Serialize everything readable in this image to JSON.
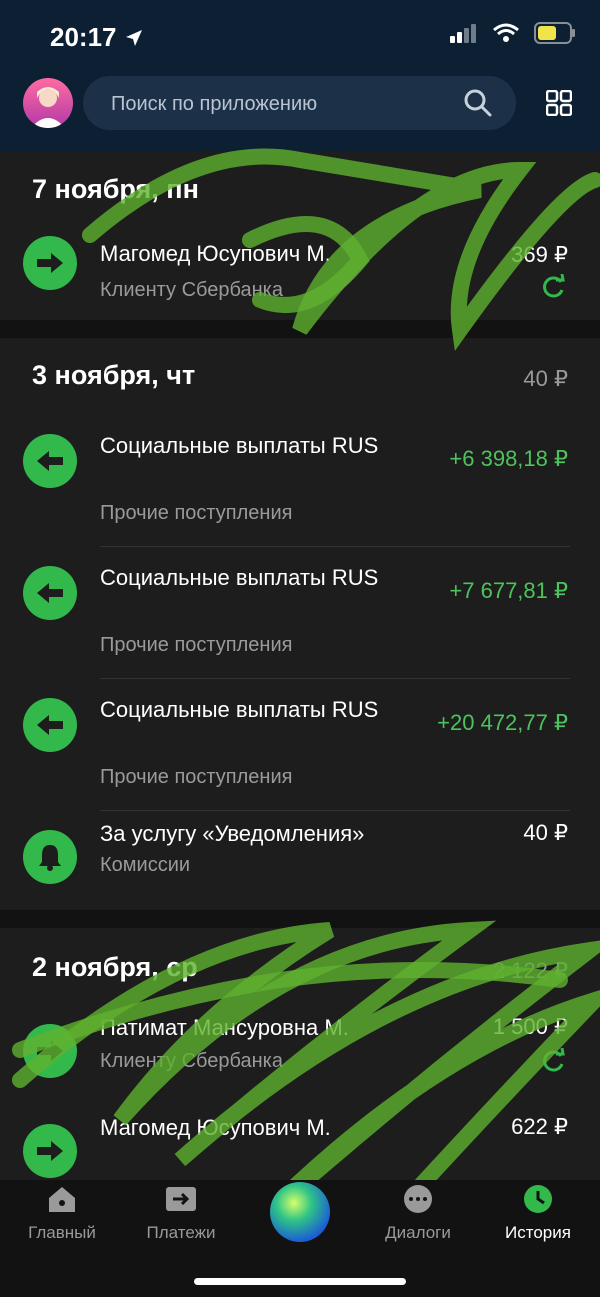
{
  "status": {
    "time": "20:17"
  },
  "search": {
    "placeholder": "Поиск по приложению"
  },
  "sections": [
    {
      "date": "7 ноября, пн",
      "total": "",
      "items": [
        {
          "title": "Магомед Юсупович М.",
          "subtitle": "Клиенту Сбербанка",
          "amount": "369 ₽",
          "icon": "transfer-icon"
        }
      ]
    },
    {
      "date": "3 ноября, чт",
      "total": "40 ₽",
      "items": [
        {
          "title": "Социальные выплаты RUS",
          "subtitle": "Прочие поступления",
          "amount": "+6 398,18 ₽",
          "icon": "arrow-left-icon"
        },
        {
          "title": "Социальные выплаты RUS",
          "subtitle": "Прочие поступления",
          "amount": "+7 677,81 ₽",
          "icon": "arrow-left-icon"
        },
        {
          "title": "Социальные выплаты RUS",
          "subtitle": "Прочие поступления",
          "amount": "+20 472,77 ₽",
          "icon": "arrow-left-icon"
        },
        {
          "title": "За услугу «Уведомления»",
          "subtitle": "Комиссии",
          "amount": "40 ₽",
          "icon": "bell-icon"
        }
      ]
    },
    {
      "date": "2 ноября, ср",
      "total": "2 122 ₽",
      "items": [
        {
          "title": "Патимат Мансуровна М.",
          "subtitle": "Клиенту Сбербанка",
          "amount": "1 500 ₽",
          "icon": "transfer-icon"
        },
        {
          "title": "Магомед Юсупович М.",
          "subtitle": "",
          "amount": "622 ₽",
          "icon": "transfer-icon"
        }
      ]
    }
  ],
  "tabs": [
    {
      "label": "Главный",
      "icon": "home-icon"
    },
    {
      "label": "Платежи",
      "icon": "payments-icon"
    },
    {
      "label": "",
      "icon": "assistant-icon"
    },
    {
      "label": "Диалоги",
      "icon": "chat-icon"
    },
    {
      "label": "История",
      "icon": "clock-icon",
      "active": true
    }
  ],
  "colors": {
    "accent": "#32b84b",
    "income": "#4cc35c",
    "header": "#0c1f33"
  }
}
